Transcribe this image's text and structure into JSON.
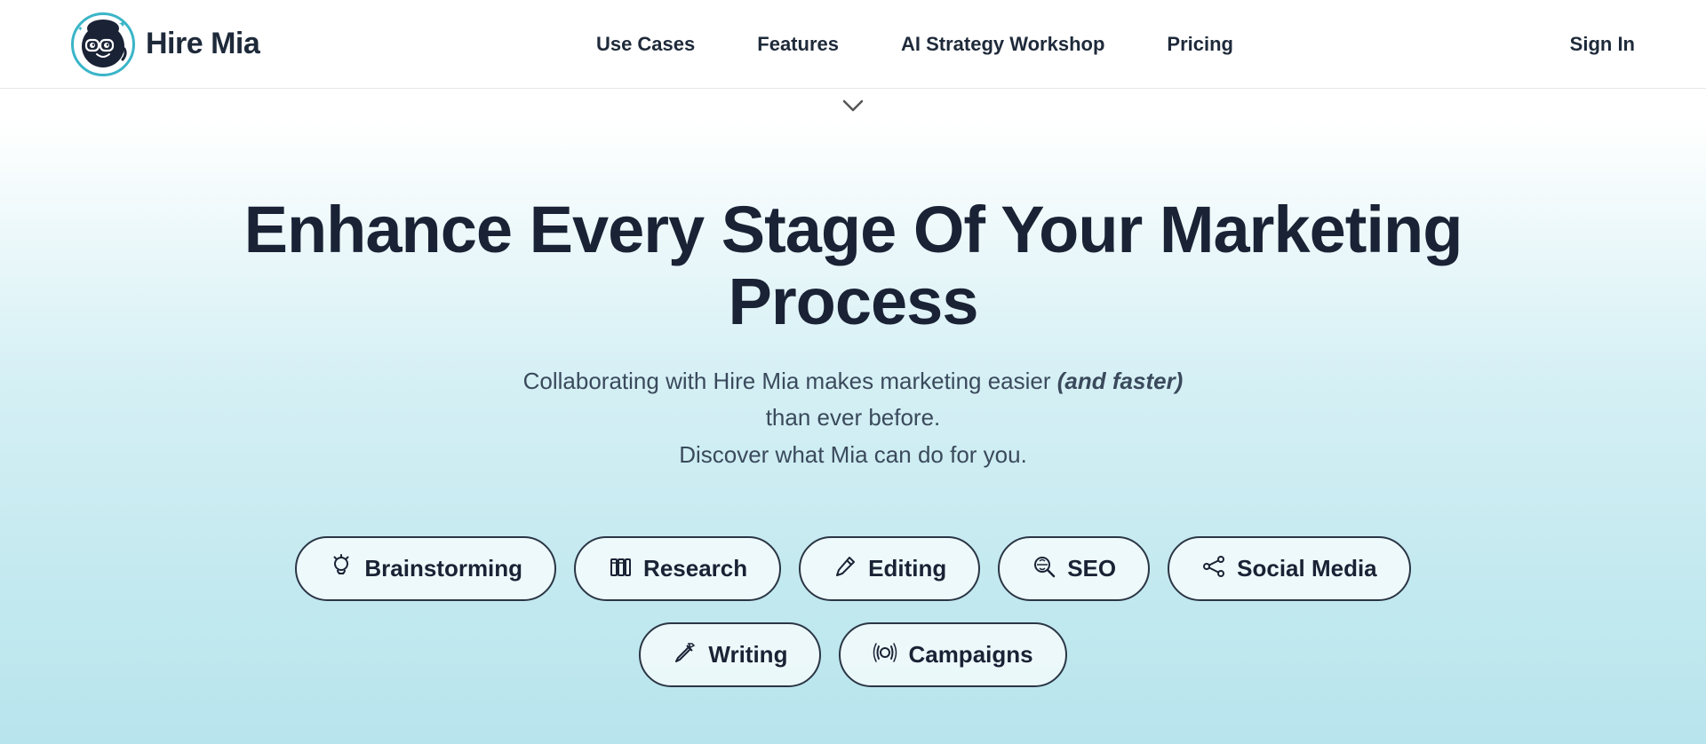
{
  "header": {
    "logo_text": "Hire Mia",
    "nav_items": [
      {
        "label": "Use Cases",
        "id": "use-cases"
      },
      {
        "label": "Features",
        "id": "features"
      },
      {
        "label": "AI Strategy Workshop",
        "id": "ai-workshop"
      },
      {
        "label": "Pricing",
        "id": "pricing"
      }
    ],
    "signin_label": "Sign In"
  },
  "hero": {
    "headline": "Enhance Every Stage Of Your Marketing Process",
    "subheadline_part1": "Collaborating with Hire Mia makes marketing easier ",
    "subheadline_italic": "(and faster)",
    "subheadline_part2": " than ever before.",
    "subheadline_line2": "Discover what Mia can do for you."
  },
  "pills_row1": [
    {
      "label": "Brainstorming",
      "icon": "bulb"
    },
    {
      "label": "Research",
      "icon": "books"
    },
    {
      "label": "Editing",
      "icon": "pencil"
    },
    {
      "label": "SEO",
      "icon": "seo"
    },
    {
      "label": "Social Media",
      "icon": "share"
    }
  ],
  "pills_row2": [
    {
      "label": "Writing",
      "icon": "edit"
    },
    {
      "label": "Campaigns",
      "icon": "campaigns"
    }
  ],
  "colors": {
    "accent": "#3ab5c8",
    "dark": "#1a2235",
    "border": "#2a3545"
  }
}
